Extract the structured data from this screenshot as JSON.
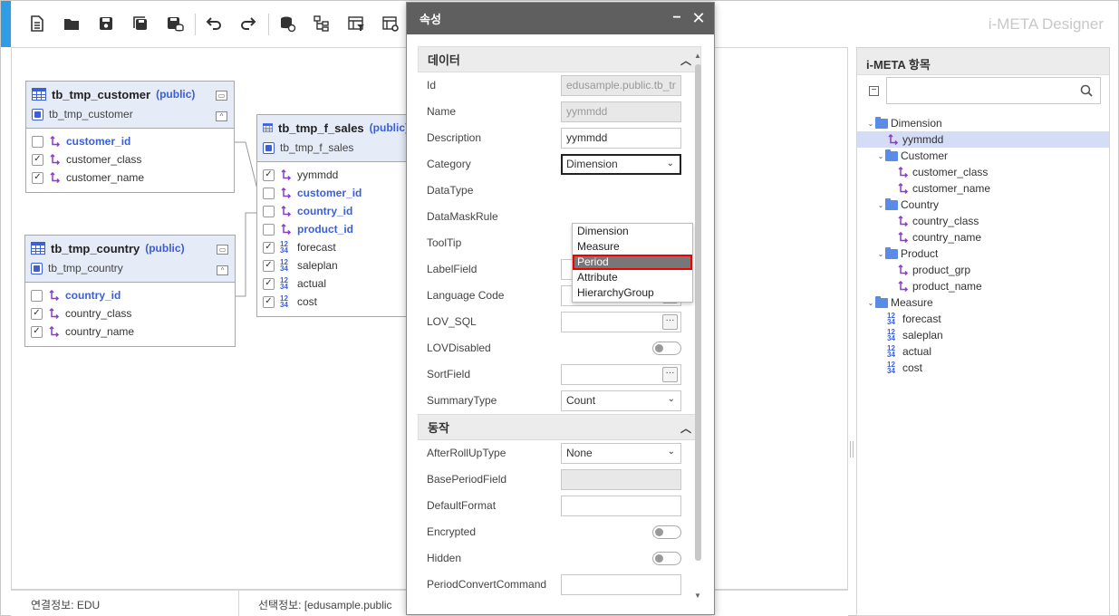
{
  "app": {
    "brand": "i-META Designer",
    "accent_color": "#2e9de6"
  },
  "toolbar": {
    "buttons": [
      "new-document-icon",
      "open-folder-icon",
      "save-icon",
      "save-all-icon",
      "save-db-icon",
      "undo-icon",
      "redo-icon",
      "database-link-icon",
      "hierarchy-icon",
      "table-filter-icon",
      "table-settings-icon"
    ]
  },
  "tables": {
    "customer": {
      "name": "tb_tmp_customer",
      "schema": "(public)",
      "sub": "tb_tmp_customer",
      "rows": [
        {
          "label": "customer_id",
          "checked": false,
          "key": true,
          "kind": "dim"
        },
        {
          "label": "customer_class",
          "checked": true,
          "key": false,
          "kind": "dim"
        },
        {
          "label": "customer_name",
          "checked": true,
          "key": false,
          "kind": "dim"
        }
      ]
    },
    "country": {
      "name": "tb_tmp_country",
      "schema": "(public)",
      "sub": "tb_tmp_country",
      "rows": [
        {
          "label": "country_id",
          "checked": false,
          "key": true,
          "kind": "dim"
        },
        {
          "label": "country_class",
          "checked": true,
          "key": false,
          "kind": "dim"
        },
        {
          "label": "country_name",
          "checked": true,
          "key": false,
          "kind": "dim"
        }
      ]
    },
    "sales": {
      "name": "tb_tmp_f_sales",
      "schema": "(public)",
      "sub": "tb_tmp_f_sales",
      "rows": [
        {
          "label": "yymmdd",
          "checked": true,
          "key": false,
          "kind": "dim"
        },
        {
          "label": "customer_id",
          "checked": false,
          "key": true,
          "kind": "dim"
        },
        {
          "label": "country_id",
          "checked": false,
          "key": true,
          "kind": "dim"
        },
        {
          "label": "product_id",
          "checked": false,
          "key": true,
          "kind": "dim"
        },
        {
          "label": "forecast",
          "checked": true,
          "key": false,
          "kind": "num"
        },
        {
          "label": "saleplan",
          "checked": true,
          "key": false,
          "kind": "num"
        },
        {
          "label": "actual",
          "checked": true,
          "key": false,
          "kind": "num"
        },
        {
          "label": "cost",
          "checked": true,
          "key": false,
          "kind": "num"
        }
      ]
    }
  },
  "status": {
    "connection": "연결정보: EDU",
    "selection": "선택정보: [edusample.public"
  },
  "props": {
    "title": "속성",
    "section_data": "데이터",
    "section_action": "동작",
    "fields": {
      "id": {
        "label": "Id",
        "value": "edusample.public.tb_tr"
      },
      "name": {
        "label": "Name",
        "value": "yymmdd"
      },
      "description": {
        "label": "Description",
        "value": "yymmdd"
      },
      "category": {
        "label": "Category",
        "value": "Dimension"
      },
      "datatype": {
        "label": "DataType"
      },
      "datamask": {
        "label": "DataMaskRule"
      },
      "tooltip": {
        "label": "ToolTip"
      },
      "labelfield": {
        "label": "LabelField"
      },
      "langcode": {
        "label": "Language Code"
      },
      "lovsql": {
        "label": "LOV_SQL"
      },
      "lovdisabled": {
        "label": "LOVDisabled"
      },
      "sortfield": {
        "label": "SortField"
      },
      "summarytype": {
        "label": "SummaryType",
        "value": "Count"
      },
      "afterrollup": {
        "label": "AfterRollUpType",
        "value": "None"
      },
      "baseperiod": {
        "label": "BasePeriodField"
      },
      "defaultformat": {
        "label": "DefaultFormat"
      },
      "encrypted": {
        "label": "Encrypted"
      },
      "hidden": {
        "label": "Hidden"
      },
      "periodconvert": {
        "label": "PeriodConvertCommand"
      }
    },
    "category_options": [
      "Dimension",
      "Measure",
      "Period",
      "Attribute",
      "HierarchyGroup"
    ],
    "category_highlighted": "Period",
    "dots_label": "···"
  },
  "meta": {
    "title": "i-META 항목",
    "tree": [
      {
        "label": "Dimension",
        "type": "folder",
        "level": 0,
        "expanded": true
      },
      {
        "label": "yymmdd",
        "type": "dim",
        "level": 1,
        "selected": true
      },
      {
        "label": "Customer",
        "type": "folder",
        "level": 1,
        "expanded": true
      },
      {
        "label": "customer_class",
        "type": "dim",
        "level": 2
      },
      {
        "label": "customer_name",
        "type": "dim",
        "level": 2
      },
      {
        "label": "Country",
        "type": "folder",
        "level": 1,
        "expanded": true
      },
      {
        "label": "country_class",
        "type": "dim",
        "level": 2
      },
      {
        "label": "country_name",
        "type": "dim",
        "level": 2
      },
      {
        "label": "Product",
        "type": "folder",
        "level": 1,
        "expanded": true
      },
      {
        "label": "product_grp",
        "type": "dim",
        "level": 2
      },
      {
        "label": "product_name",
        "type": "dim",
        "level": 2
      },
      {
        "label": "Measure",
        "type": "folder",
        "level": 0,
        "expanded": true
      },
      {
        "label": "forecast",
        "type": "num",
        "level": 1
      },
      {
        "label": "saleplan",
        "type": "num",
        "level": 1
      },
      {
        "label": "actual",
        "type": "num",
        "level": 1
      },
      {
        "label": "cost",
        "type": "num",
        "level": 1
      }
    ]
  }
}
